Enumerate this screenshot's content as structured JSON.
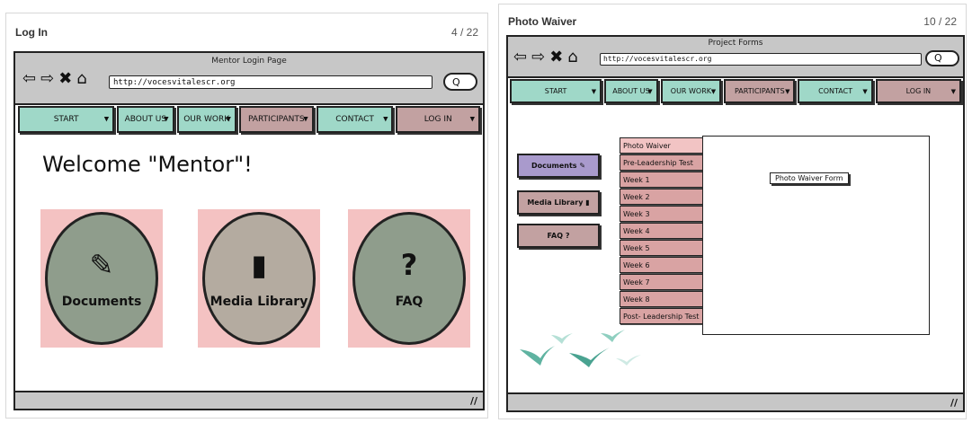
{
  "left": {
    "panel_title": "Log In",
    "page_count": "4 / 22",
    "window_title": "Mentor Login Page",
    "url": "http://vocesvitalescr.org",
    "search_label": "Q",
    "nav": [
      {
        "label": "START",
        "color": "#9fd8c8"
      },
      {
        "label": "ABOUT US",
        "color": "#9fd8c8"
      },
      {
        "label": "OUR WORK",
        "color": "#9fd8c8"
      },
      {
        "label": "PARTICIPANTS",
        "color": "#c2a1a1"
      },
      {
        "label": "CONTACT",
        "color": "#9fd8c8"
      },
      {
        "label": "LOG IN",
        "color": "#c2a1a1"
      }
    ],
    "welcome": "Welcome \"Mentor\"!",
    "tiles": [
      {
        "label": "Documents",
        "icon": "edit-icon",
        "glyph": "✎",
        "oval_color": "#8f9d8c"
      },
      {
        "label": "Media Library",
        "icon": "book-icon",
        "glyph": "▮",
        "oval_color": "#b4aba0"
      },
      {
        "label": "FAQ",
        "icon": "question-icon",
        "glyph": "?",
        "oval_color": "#8f9d8c"
      }
    ],
    "grip": "//"
  },
  "right": {
    "panel_title": "Photo Waiver",
    "page_count": "10 / 22",
    "window_title": "Project Forms",
    "url": "http://vocesvitalescr.org",
    "search_label": "Q",
    "nav": [
      {
        "label": "START",
        "color": "#9fd8c8"
      },
      {
        "label": "ABOUT US",
        "color": "#9fd8c8"
      },
      {
        "label": "OUR WORK",
        "color": "#9fd8c8"
      },
      {
        "label": "PARTICIPANTS",
        "color": "#c2a1a1"
      },
      {
        "label": "CONTACT",
        "color": "#9fd8c8"
      },
      {
        "label": "LOG IN",
        "color": "#c2a1a1"
      }
    ],
    "side_buttons": [
      {
        "label": "Documents",
        "glyph": "✎",
        "color": "#a99acc"
      },
      {
        "label": "Media Library",
        "glyph": "▮",
        "color": "#c2a1a1"
      },
      {
        "label": "FAQ",
        "glyph": "?",
        "color": "#c2a1a1"
      }
    ],
    "weeks": [
      "Photo Waiver",
      "Pre-Leadership Test",
      "Week 1",
      "Week 2",
      "Week 3",
      "Week 4",
      "Week 5",
      "Week 6",
      "Week 7",
      "Week 8",
      "Post- Leadership Test"
    ],
    "form_label": "Photo Waiver Form",
    "grip": "//"
  }
}
